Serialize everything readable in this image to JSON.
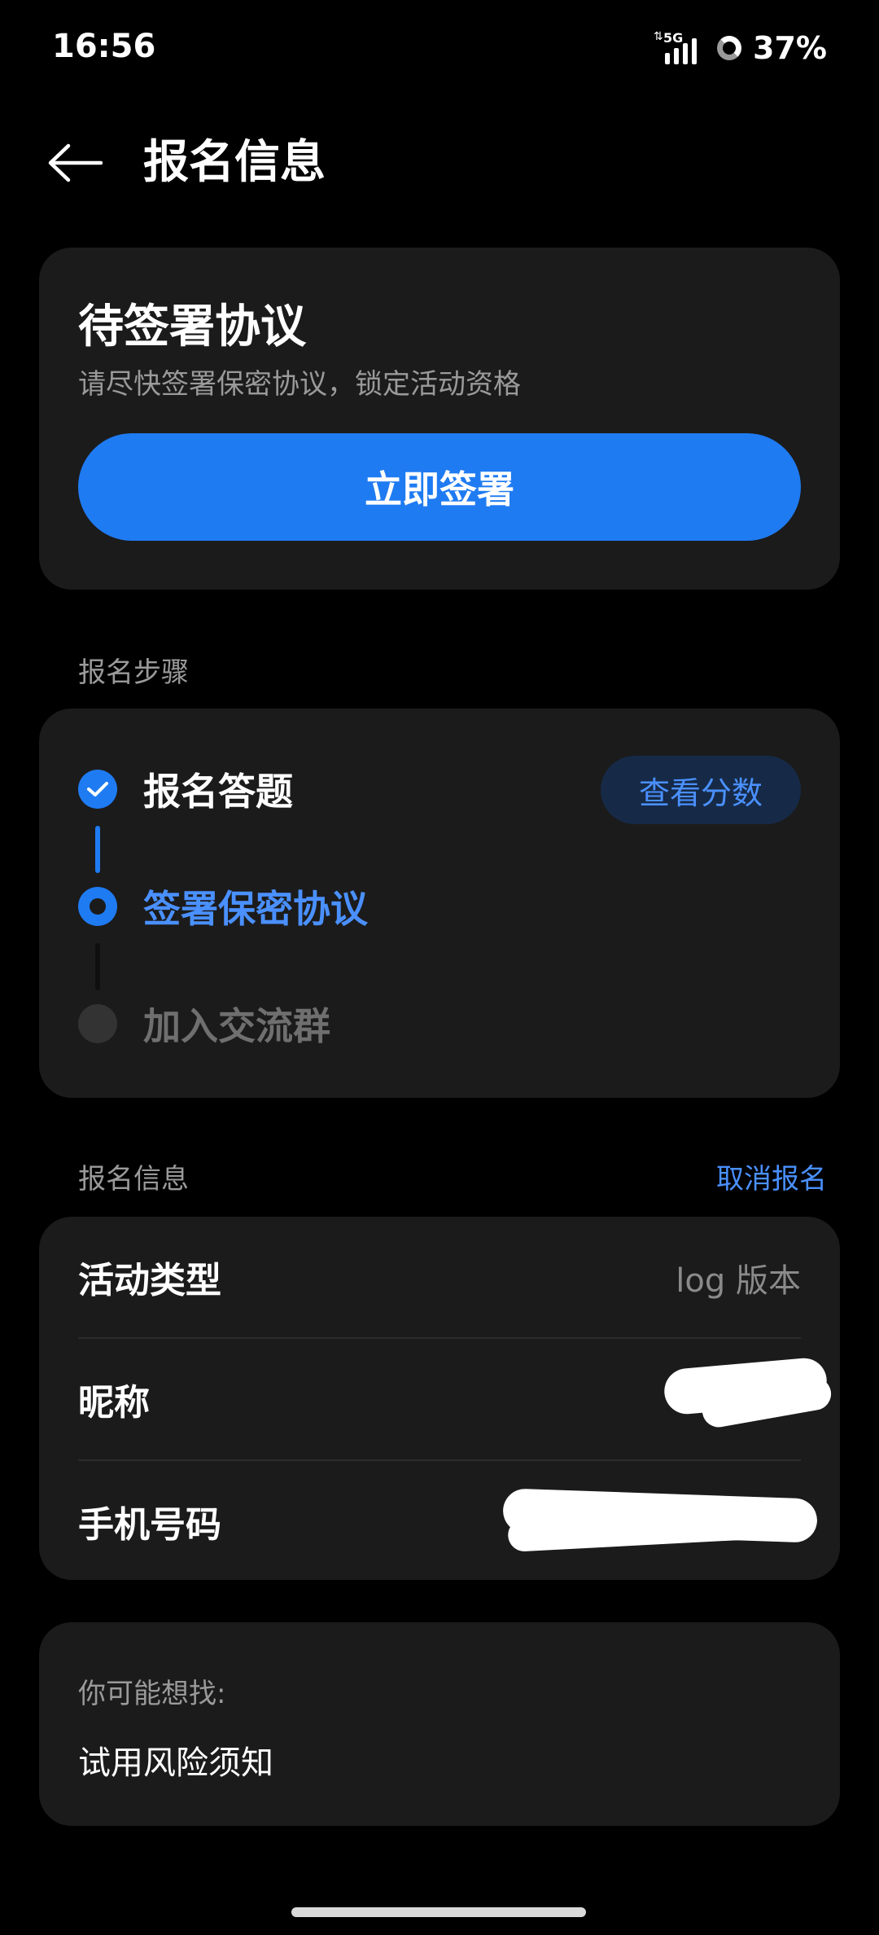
{
  "status_bar": {
    "time": "16:56",
    "network_label": "5G",
    "battery_percent": "37%",
    "battery_level": 0.37
  },
  "header": {
    "title": "报名信息",
    "back_icon": "arrow-left-icon"
  },
  "pending_agreement": {
    "title": "待签署协议",
    "description": "请尽快签署保密协议，锁定活动资格",
    "button_label": "立即签署",
    "button_color": "#1f7bf2"
  },
  "steps_section": {
    "label": "报名步骤",
    "score_button_label": "查看分数",
    "steps": [
      {
        "label": "报名答题",
        "state": "done"
      },
      {
        "label": "签署保密协议",
        "state": "current"
      },
      {
        "label": "加入交流群",
        "state": "pending"
      }
    ]
  },
  "info_section": {
    "label": "报名信息",
    "cancel_label": "取消报名",
    "rows": [
      {
        "label": "活动类型",
        "value": "log 版本"
      },
      {
        "label": "昵称",
        "value": ""
      },
      {
        "label": "手机号码",
        "value": ""
      }
    ]
  },
  "suggest_section": {
    "label": "你可能想找:",
    "item": "试用风险须知"
  },
  "colors": {
    "accent": "#1f7bf2",
    "accent_text": "#4a90ff",
    "card_bg": "#1b1b1b",
    "page_bg": "#000000"
  }
}
